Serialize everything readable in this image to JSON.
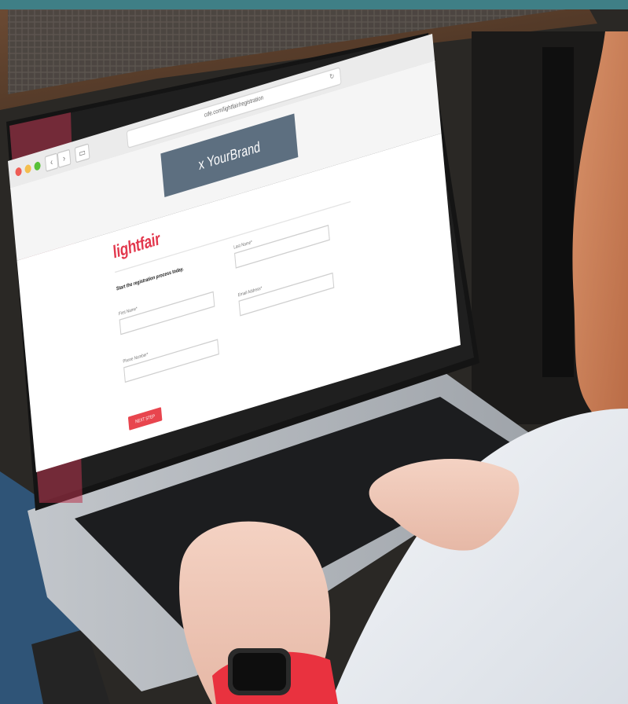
{
  "browser": {
    "url": "cde.com/lightfair/registration"
  },
  "page": {
    "brand_banner": "x YourBrand",
    "logo": "lightfair",
    "intro": "Start the registration process today.",
    "fields": {
      "first_name_label": "First Name*",
      "last_name_label": "Last Name*",
      "email_label": "Email Address*",
      "phone_label": "Phone Number*"
    },
    "next_button": "NEXT STEP"
  },
  "colors": {
    "background_frame": "#3f7f86",
    "brand_accent": "#e2384d",
    "banner": "#5d6f80"
  }
}
